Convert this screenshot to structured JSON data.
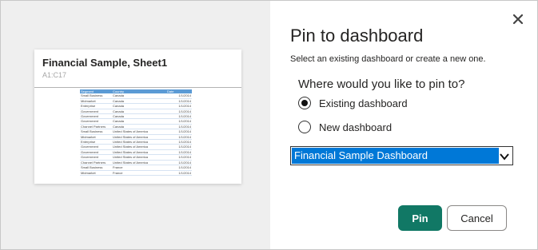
{
  "preview": {
    "tile_title": "Financial Sample, Sheet1",
    "tile_range": "A1:C17",
    "table": {
      "headers": [
        "Segment",
        "Country",
        "Date"
      ],
      "rows": [
        [
          "Small Business",
          "Canada",
          "1/1/2014"
        ],
        [
          "Midmarket",
          "Canada",
          "1/1/2014"
        ],
        [
          "Enterprise",
          "Canada",
          "1/1/2014"
        ],
        [
          "Government",
          "Canada",
          "1/1/2014"
        ],
        [
          "Government",
          "Canada",
          "1/1/2014"
        ],
        [
          "Government",
          "Canada",
          "1/1/2014"
        ],
        [
          "Channel Partners",
          "Canada",
          "1/1/2014"
        ],
        [
          "Small Business",
          "United States of America",
          "1/1/2014"
        ],
        [
          "Midmarket",
          "United States of America",
          "1/1/2014"
        ],
        [
          "Enterprise",
          "United States of America",
          "1/1/2014"
        ],
        [
          "Government",
          "United States of America",
          "1/1/2014"
        ],
        [
          "Government",
          "United States of America",
          "1/1/2014"
        ],
        [
          "Government",
          "United States of America",
          "1/1/2014"
        ],
        [
          "Channel Partners",
          "United States of America",
          "1/1/2014"
        ],
        [
          "Small Business",
          "France",
          "1/1/2014"
        ],
        [
          "Midmarket",
          "France",
          "1/1/2014"
        ]
      ]
    }
  },
  "dialog": {
    "title": "Pin to dashboard",
    "subtitle": "Select an existing dashboard or create a new one.",
    "question": "Where would you like to pin to?",
    "options": [
      {
        "label": "Existing dashboard",
        "selected": true
      },
      {
        "label": "New dashboard",
        "selected": false
      }
    ],
    "dashboard_select": {
      "value": "Financial Sample Dashboard"
    },
    "pin_label": "Pin",
    "cancel_label": "Cancel",
    "close_icon": "close-icon"
  },
  "colors": {
    "primary_button": "#117865",
    "select_highlight": "#0078d7",
    "table_header": "#5b9bd5"
  }
}
